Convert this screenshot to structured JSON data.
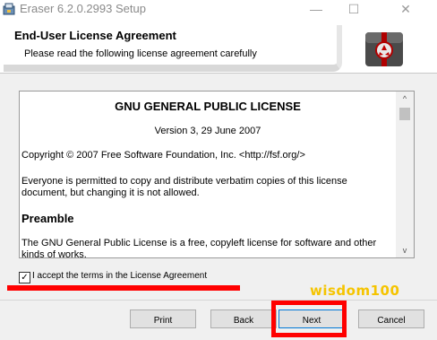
{
  "window": {
    "title": "Eraser 6.2.0.2993 Setup",
    "minimize_glyph": "—",
    "maximize_glyph": "☐",
    "close_glyph": "✕",
    "app_icon": "installer-icon"
  },
  "header": {
    "title": "End-User License Agreement",
    "subtitle": "Please read the following license agreement carefully",
    "logo": "eraser-logo-icon"
  },
  "license": {
    "title": "GNU GENERAL PUBLIC LICENSE",
    "version": "Version 3, 29 June 2007",
    "copyright": "Copyright © 2007 Free Software Foundation, Inc. <http://fsf.org/>",
    "everyone": "Everyone is permitted to copy and distribute verbatim copies of this license document, but changing it is not allowed.",
    "preamble": "Preamble",
    "gnu_paragraph": "The GNU General Public License is a free, copyleft license for software and other kinds of works."
  },
  "scrollbar": {
    "up_glyph": "^",
    "down_glyph": "v"
  },
  "accept": {
    "label": "I accept the terms in the License Agreement",
    "checked": true,
    "check_glyph": "✓"
  },
  "watermark": "wisdom100",
  "buttons": {
    "print": "Print",
    "back": "Back",
    "next": "Next",
    "cancel": "Cancel"
  },
  "colors": {
    "annotation_red": "#ff0000",
    "watermark_yellow": "#f5c400",
    "focus_blue": "#0078d7"
  }
}
